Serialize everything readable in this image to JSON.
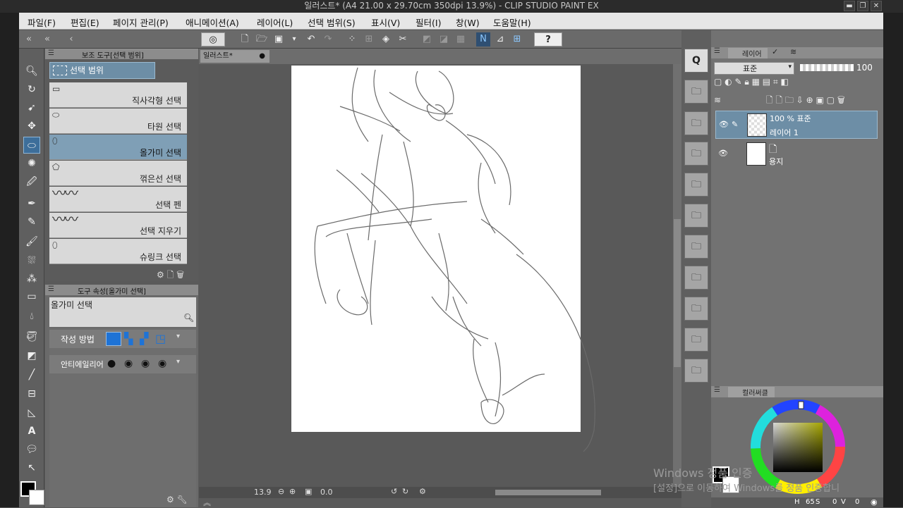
{
  "window": {
    "title": "일러스트* (A4 21.00 x 29.70cm 350dpi 13.9%) - CLIP STUDIO PAINT EX",
    "buttons": {
      "minimize": "▬",
      "restore": "❐",
      "close": "✕"
    }
  },
  "menu": [
    "파일(F)",
    "편집(E)",
    "페이지 관리(P)",
    "애니메이션(A)",
    "레이어(L)",
    "선택 범위(S)",
    "표시(V)",
    "필터(I)",
    "창(W)",
    "도움말(H)"
  ],
  "subtool_panel": {
    "tab_label": "보조 도구[선택 범위]",
    "group": "선택 범위",
    "items": [
      "직사각형 선택",
      "타원 선택",
      "올가미 선택",
      "꺾은선 선택",
      "선택 펜",
      "선택 지우기",
      "슈링크 선택"
    ],
    "selected": "올가미 선택"
  },
  "tool_property": {
    "tab_label": "도구 속성[올가미 선택]",
    "tool_name": "올가미 선택",
    "rows": {
      "create_method": "작성 방법",
      "antialias": "안티에일리어"
    }
  },
  "canvas": {
    "tab_label": "일러스트*",
    "zoom": "13.9",
    "rotation": "0.0"
  },
  "layer_panel": {
    "tab_label": "레이어",
    "blend_mode": "표준",
    "opacity": "100",
    "layers": [
      {
        "line1": "100 % 표준",
        "line2": "레이어 1",
        "selected": true
      },
      {
        "line1": "",
        "line2": "용지",
        "selected": false
      }
    ]
  },
  "color_panel": {
    "tab_label": "컬러써클",
    "hue_label": "H",
    "hue": "65",
    "sat_label": "S",
    "sat": "0",
    "val_label": "V",
    "val": "0",
    "colors": {
      "main": "#000000",
      "sub": "#ffffff",
      "square": "#a6a600"
    }
  },
  "watermark": {
    "line1": "Windows 정품 인증",
    "line2": "[설정]으로 이동하여 Windows를 정품 인증합니"
  },
  "colors": {
    "panel_bg": "#5f5f5f",
    "selected_blue": "#6d8ea6",
    "menu_bg": "#e6e6e6"
  }
}
